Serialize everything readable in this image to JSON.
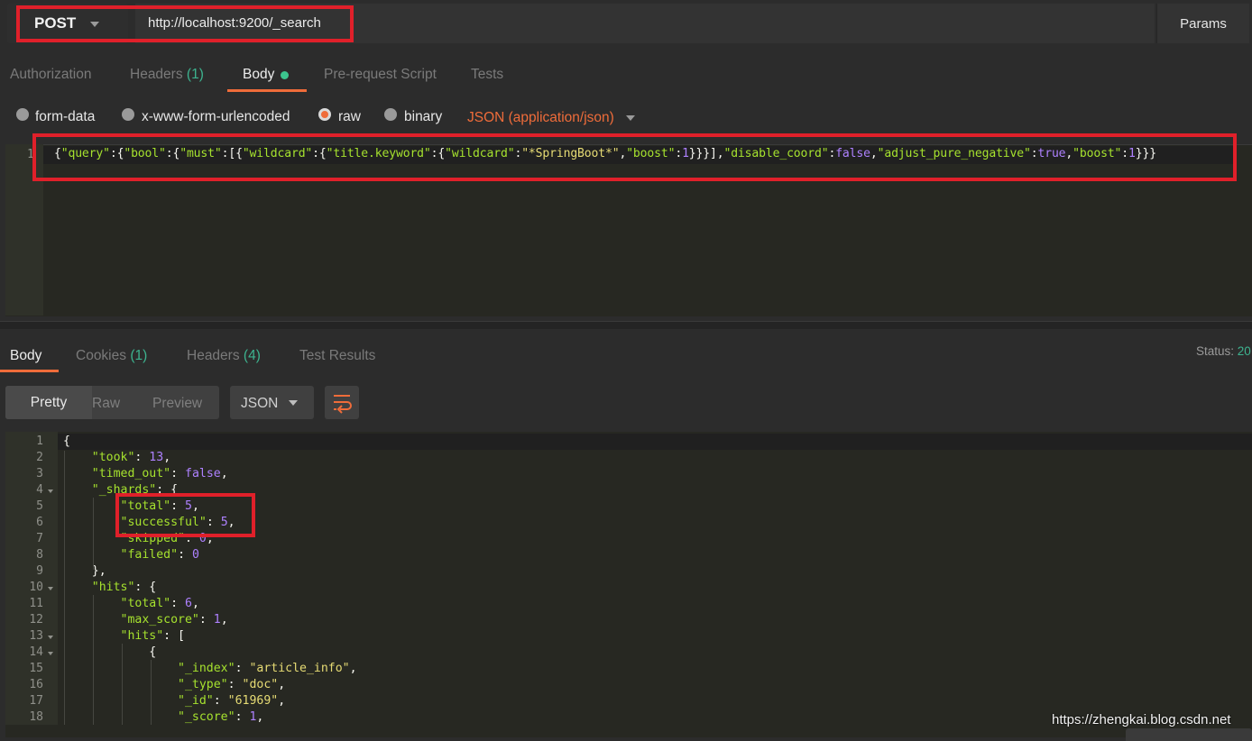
{
  "request": {
    "method": "POST",
    "url": "http://localhost:9200/_search",
    "params_label": "Params"
  },
  "request_tabs": [
    {
      "label": "Authorization"
    },
    {
      "label": "Headers",
      "count": "(1)"
    },
    {
      "label": "Body",
      "active": true
    },
    {
      "label": "Pre-request Script"
    },
    {
      "label": "Tests"
    }
  ],
  "body_types": {
    "form_data": "form-data",
    "urlencoded": "x-www-form-urlencoded",
    "raw": "raw",
    "binary": "binary",
    "selected": "raw",
    "content_type": "JSON (application/json)"
  },
  "request_body": {
    "line_number": "1",
    "code": "{\"query\":{\"bool\":{\"must\":[{\"wildcard\":{\"title.keyword\":{\"wildcard\":\"*SpringBoot*\",\"boost\":1}}}],\"disable_coord\":false,\"adjust_pure_negative\":true,\"boost\":1}}}"
  },
  "response_tabs": [
    {
      "label": "Body",
      "active": true
    },
    {
      "label": "Cookies",
      "count": "(1)"
    },
    {
      "label": "Headers",
      "count": "(4)"
    },
    {
      "label": "Test Results"
    }
  ],
  "status": {
    "label": "Status:",
    "value": "20"
  },
  "view_modes": {
    "pretty": "Pretty",
    "raw": "Raw",
    "preview": "Preview",
    "format": "JSON"
  },
  "response_lines": {
    "numbers": [
      "1",
      "2",
      "3",
      "4",
      "5",
      "6",
      "7",
      "8",
      "9",
      "10",
      "11",
      "12",
      "13",
      "14",
      "15",
      "16",
      "17",
      "18"
    ],
    "took_key": "\"took\"",
    "took_val": "13",
    "timed_out_key": "\"timed_out\"",
    "timed_out_val": "false",
    "shards_key": "\"_shards\"",
    "total_key": "\"total\"",
    "total_val": "5",
    "successful_key": "\"successful\"",
    "successful_val": "5",
    "skipped_key": "\"skipped\"",
    "skipped_val": "0",
    "failed_key": "\"failed\"",
    "failed_val": "0",
    "hits_key": "\"hits\"",
    "hits_total_key": "\"total\"",
    "hits_total_val": "6",
    "max_score_key": "\"max_score\"",
    "max_score_val": "1",
    "hits_arr_key": "\"hits\"",
    "index_key": "\"_index\"",
    "index_val": "\"article_info\"",
    "type_key": "\"_type\"",
    "type_val": "\"doc\"",
    "id_key": "\"_id\"",
    "id_val": "\"61969\"",
    "score_key": "\"_score\"",
    "score_val": "1"
  },
  "watermark": "https://zhengkai.blog.csdn.net",
  "colors": {
    "accent": "#ef6c3a",
    "count_green": "#3db38f",
    "annotation_red": "#e0202a",
    "json_key": "#a6e22e",
    "json_string": "#e6db74",
    "json_number": "#ae81ff"
  }
}
